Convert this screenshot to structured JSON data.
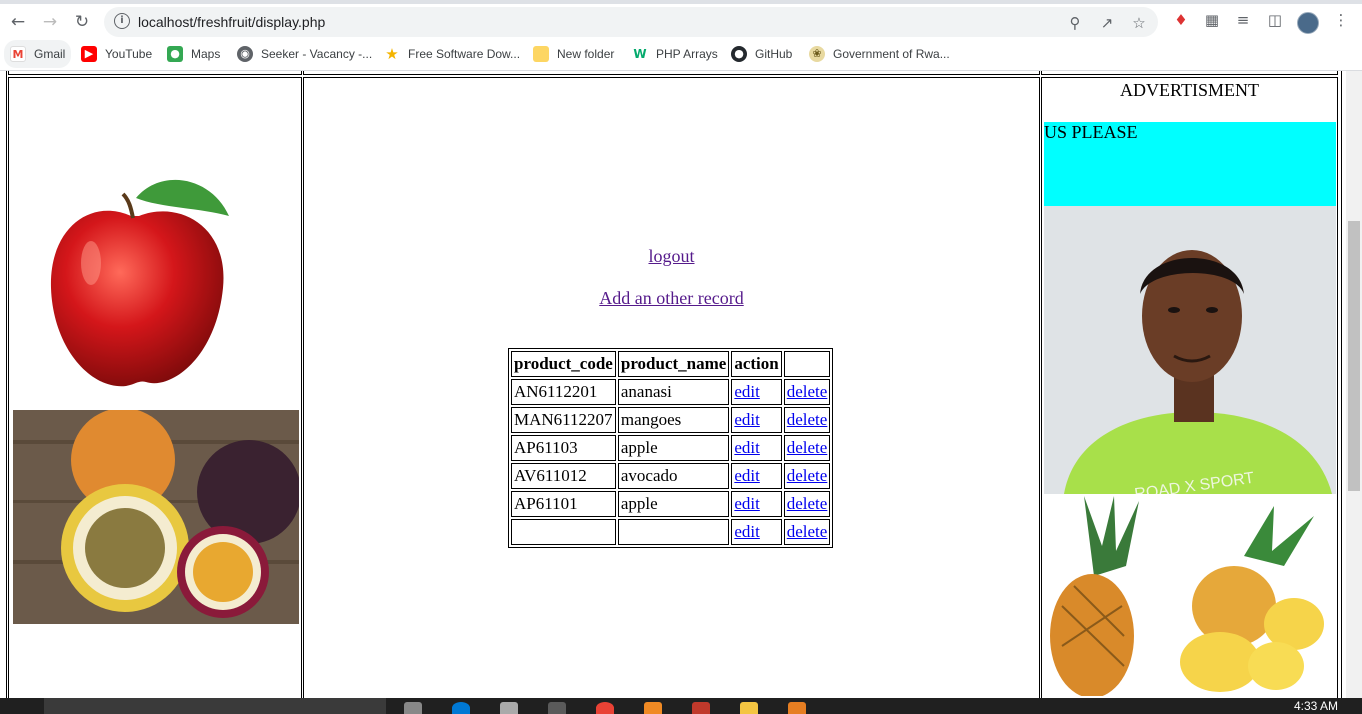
{
  "browser": {
    "url": "localhost/freshfruit/display.php",
    "bookmarks": [
      {
        "label": "Gmail",
        "icon": "gmail-icon"
      },
      {
        "label": "YouTube",
        "icon": "youtube-icon"
      },
      {
        "label": "Maps",
        "icon": "maps-icon"
      },
      {
        "label": "Seeker - Vacancy -...",
        "icon": "globe-icon"
      },
      {
        "label": "Free Software Dow...",
        "icon": "star-icon"
      },
      {
        "label": "New folder",
        "icon": "folder-icon"
      },
      {
        "label": "PHP Arrays",
        "icon": "w3-icon"
      },
      {
        "label": "GitHub",
        "icon": "github-icon"
      },
      {
        "label": "Government of Rwa...",
        "icon": "seal-icon"
      }
    ]
  },
  "page": {
    "logout_label": "logout",
    "add_record_label": "Add an other record",
    "table": {
      "headers": [
        "product_code",
        "product_name",
        "action"
      ],
      "edit_label": "edit",
      "delete_label": "delete",
      "rows": [
        {
          "code": "AN6112201",
          "name": "ananasi"
        },
        {
          "code": "MAN6112207",
          "name": "mangoes"
        },
        {
          "code": "AP61103",
          "name": "apple"
        },
        {
          "code": "AV611012",
          "name": "avocado"
        },
        {
          "code": "AP61101",
          "name": "apple"
        },
        {
          "code": "",
          "name": ""
        }
      ]
    },
    "ad": {
      "title": "ADVERTISMENT",
      "banner_text": "US PLEASE",
      "banner_color": "#00ffff"
    }
  },
  "taskbar": {
    "time": "4:33 AM"
  }
}
